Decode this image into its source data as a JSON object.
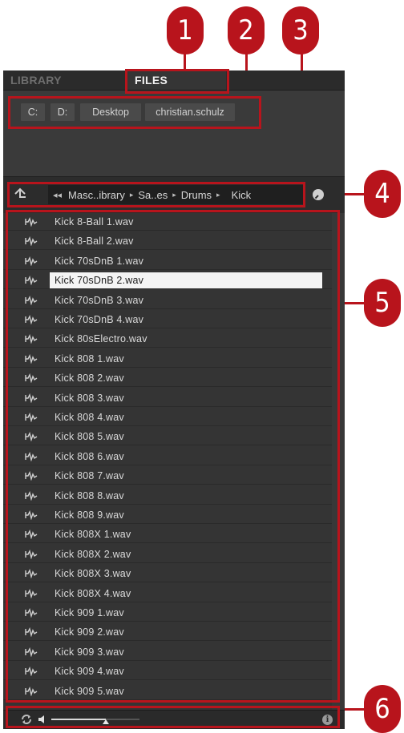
{
  "tabs": {
    "library": "LIBRARY",
    "files": "FILES"
  },
  "drives": [
    "C:",
    "D:",
    "Desktop",
    "christian.schulz"
  ],
  "path": {
    "back_glyph": "◂◂",
    "crumbs": [
      "Masc..ibrary",
      "Sa..es",
      "Drums",
      "Kick"
    ],
    "separator": "▸"
  },
  "files": [
    "Kick 8-Ball 1.wav",
    "Kick 8-Ball 2.wav",
    "Kick 70sDnB 1.wav",
    "Kick 70sDnB 2.wav",
    "Kick 70sDnB 3.wav",
    "Kick 70sDnB 4.wav",
    "Kick 80sElectro.wav",
    "Kick 808 1.wav",
    "Kick 808 2.wav",
    "Kick 808 3.wav",
    "Kick 808 4.wav",
    "Kick 808 5.wav",
    "Kick 808 6.wav",
    "Kick 808 7.wav",
    "Kick 808 8.wav",
    "Kick 808 9.wav",
    "Kick 808X 1.wav",
    "Kick 808X 2.wav",
    "Kick 808X 3.wav",
    "Kick 808X 4.wav",
    "Kick 909 1.wav",
    "Kick 909 2.wav",
    "Kick 909 3.wav",
    "Kick 909 4.wav",
    "Kick 909 5.wav"
  ],
  "selected_index": 3,
  "footer": {
    "info_label": "i",
    "volume_level": 0.62
  },
  "callouts": [
    "1",
    "2",
    "3",
    "4",
    "5",
    "6"
  ],
  "colors": {
    "accent": "#b8141c",
    "panel": "#353535",
    "tab_bar": "#2b2b2b",
    "selected_row": "#f4f4f4"
  },
  "icons": {
    "up": "up-arrow-icon",
    "history": "history-clock-icon",
    "file": "audio-waveform-icon",
    "loop": "prehear-loop-icon",
    "speaker": "speaker-icon",
    "info": "info-icon"
  }
}
